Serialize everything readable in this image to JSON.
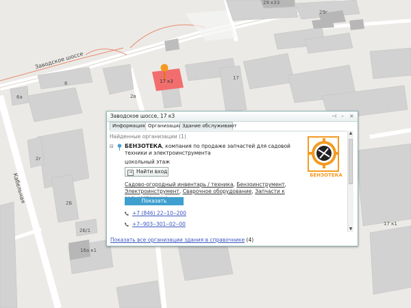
{
  "map": {
    "house_labels": [
      {
        "text": "29 к33",
        "name": "house-label-29k33"
      },
      {
        "text": "29г",
        "name": "house-label-29g"
      },
      {
        "text": "6а",
        "name": "house-label-6a"
      },
      {
        "text": "6",
        "name": "house-label-6"
      },
      {
        "text": "2г",
        "name": "house-label-2g"
      },
      {
        "text": "2в",
        "name": "house-label-2v"
      },
      {
        "text": "17",
        "name": "house-label-17"
      },
      {
        "text": "17 к3",
        "name": "house-label-17k3"
      },
      {
        "text": "2Б",
        "name": "house-label-2b"
      },
      {
        "text": "2Б/1",
        "name": "house-label-2b1"
      },
      {
        "text": "16а к1",
        "name": "house-label-16ak1"
      },
      {
        "text": "17 к1",
        "name": "house-label-17k1"
      }
    ],
    "street_labels": [
      "Заводское шоссе",
      "Кабельная"
    ]
  },
  "popup": {
    "title": "Заводское шоссе, 17 к3",
    "buttons": {
      "pin": "⊣",
      "minimize": "–",
      "close": "×"
    },
    "tabs": [
      "Информация",
      "Организации",
      "Здание обслуживают"
    ],
    "found": "Найденные организации (1)",
    "org": {
      "name": "БЕНЗОТЕКА",
      "desc": ", компания по продаже запчастей для садовой техники и электроинструмента",
      "floor": "цокольный этаж",
      "find_button": "Найти вход",
      "categories": [
        "Садово-огородный инвентарь / техника",
        "Бензоинструмент",
        "Электроинструмент",
        "Сварочное оборудование",
        "Запчасти к сельхозтехнике"
      ],
      "photos_button": "Показать фотографии",
      "phones": [
        "+7 (846) 22‒10‒200",
        "+7‒903‒301‒02‒00"
      ],
      "logo_text": "БЕНЗОТЕКА"
    },
    "all_link": "Показать все организации здания в справочнике",
    "all_count": "(4)"
  },
  "colors": {
    "accent": "#3f9fcf",
    "link": "#3a55c0",
    "building": "#cfcfcf",
    "highlight": "#f26e6e",
    "marker": "#f39a21"
  }
}
